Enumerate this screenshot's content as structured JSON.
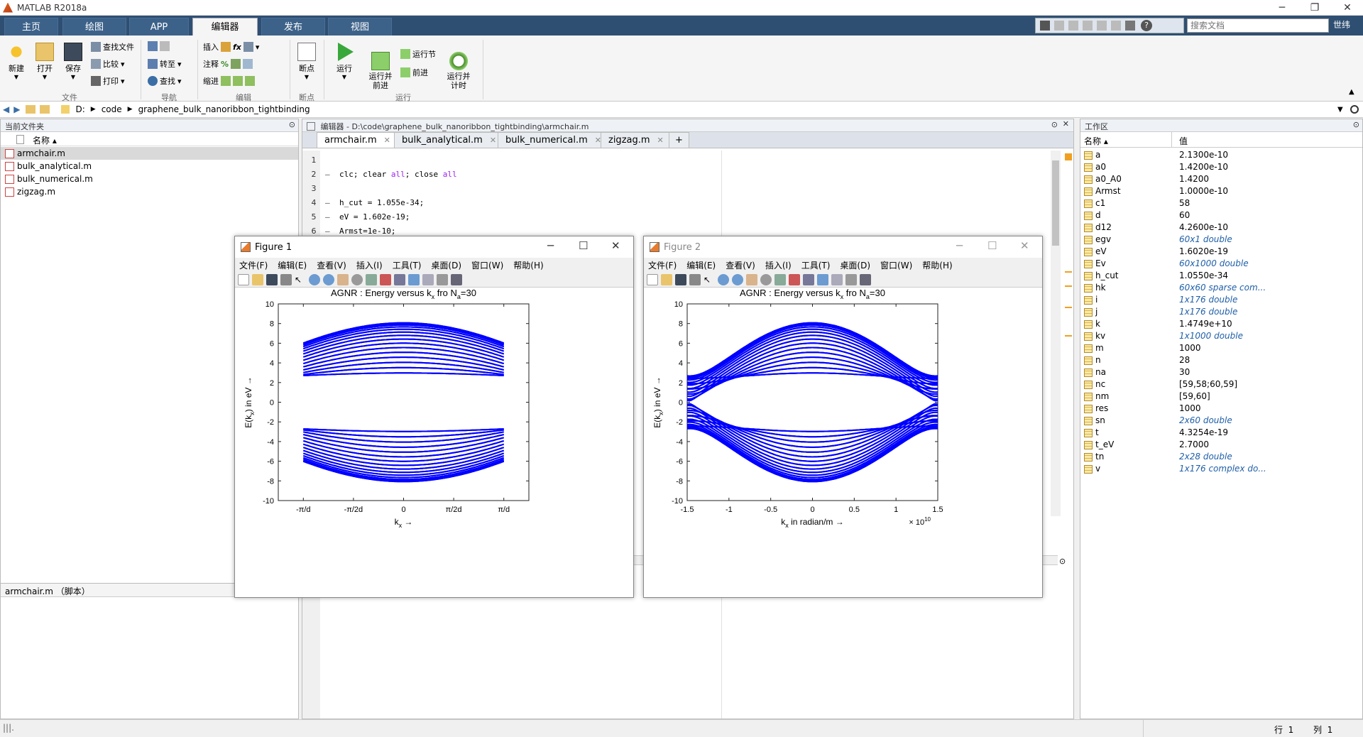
{
  "app": {
    "title": "MATLAB R2018a"
  },
  "main_tabs": [
    {
      "label": "主页"
    },
    {
      "label": "绘图"
    },
    {
      "label": "APP"
    },
    {
      "label": "编辑器"
    },
    {
      "label": "发布"
    },
    {
      "label": "视图"
    }
  ],
  "search": {
    "placeholder": "搜索文档"
  },
  "user": "世纬",
  "ribbon": {
    "file": {
      "new": "新建",
      "open": "打开",
      "save": "保存",
      "find_files": "查找文件",
      "compare": "比较",
      "print": "打印",
      "group": "文件"
    },
    "nav": {
      "goto": "转至",
      "find": "查找",
      "group": "导航"
    },
    "edit": {
      "insert": "插入",
      "comment": "注释",
      "indent": "缩进",
      "group": "编辑"
    },
    "breakpoints": {
      "label": "断点",
      "group": "断点"
    },
    "run": {
      "run": "运行",
      "run_advance": "运行并\n前进",
      "run_section": "运行节",
      "advance": "前进",
      "run_time": "运行并\n计时",
      "group": "运行"
    }
  },
  "address": {
    "parts": [
      "D:",
      "code",
      "graphene_bulk_nanoribbon_tightbinding"
    ]
  },
  "current_folder": {
    "title": "当前文件夹",
    "column": "名称 ▴",
    "files": [
      "armchair.m",
      "bulk_analytical.m",
      "bulk_numerical.m",
      "zigzag.m"
    ],
    "details": "armchair.m （脚本）"
  },
  "editor": {
    "title": "编辑器 - D:\\code\\graphene_bulk_nanoribbon_tightbinding\\armchair.m",
    "tabs": [
      "armchair.m",
      "bulk_analytical.m",
      "bulk_numerical.m",
      "zigzag.m"
    ],
    "lines": [
      {
        "n": "1",
        "dash": "",
        "code": ""
      },
      {
        "n": "2",
        "dash": "—",
        "code": "clc; clear all; close all"
      },
      {
        "n": "3",
        "dash": "",
        "code": ""
      },
      {
        "n": "4",
        "dash": "—",
        "code": "h_cut = 1.055e-34;"
      },
      {
        "n": "5",
        "dash": "—",
        "code": "eV = 1.602e-19;"
      },
      {
        "n": "6",
        "dash": "—",
        "code": "Armst=1e-10;"
      }
    ]
  },
  "workspace": {
    "title": "工作区",
    "col_name": "名称 ▴",
    "col_value": "值",
    "vars": [
      {
        "name": "a",
        "value": "2.1300e-10",
        "italic": false
      },
      {
        "name": "a0",
        "value": "1.4200e-10",
        "italic": false
      },
      {
        "name": "a0_A0",
        "value": "1.4200",
        "italic": false
      },
      {
        "name": "Armst",
        "value": "1.0000e-10",
        "italic": false
      },
      {
        "name": "c1",
        "value": "58",
        "italic": false
      },
      {
        "name": "d",
        "value": "60",
        "italic": false
      },
      {
        "name": "d12",
        "value": "4.2600e-10",
        "italic": false
      },
      {
        "name": "egv",
        "value": "60x1 double",
        "italic": true
      },
      {
        "name": "eV",
        "value": "1.6020e-19",
        "italic": false
      },
      {
        "name": "Ev",
        "value": "60x1000 double",
        "italic": true
      },
      {
        "name": "h_cut",
        "value": "1.0550e-34",
        "italic": false
      },
      {
        "name": "hk",
        "value": "60x60 sparse com...",
        "italic": true
      },
      {
        "name": "i",
        "value": "1x176 double",
        "italic": true
      },
      {
        "name": "j",
        "value": "1x176 double",
        "italic": true
      },
      {
        "name": "k",
        "value": "1.4749e+10",
        "italic": false
      },
      {
        "name": "kv",
        "value": "1x1000 double",
        "italic": true
      },
      {
        "name": "m",
        "value": "1000",
        "italic": false
      },
      {
        "name": "n",
        "value": "28",
        "italic": false
      },
      {
        "name": "na",
        "value": "30",
        "italic": false
      },
      {
        "name": "nc",
        "value": "[59,58;60,59]",
        "italic": false
      },
      {
        "name": "nm",
        "value": "[59,60]",
        "italic": false
      },
      {
        "name": "res",
        "value": "1000",
        "italic": false
      },
      {
        "name": "sn",
        "value": "2x60 double",
        "italic": true
      },
      {
        "name": "t",
        "value": "4.3254e-19",
        "italic": false
      },
      {
        "name": "t_eV",
        "value": "2.7000",
        "italic": false
      },
      {
        "name": "tn",
        "value": "2x28 double",
        "italic": true
      },
      {
        "name": "v",
        "value": "1x176 complex do...",
        "italic": true
      }
    ]
  },
  "figure_menu": [
    "文件(F)",
    "编辑(E)",
    "查看(V)",
    "插入(I)",
    "工具(T)",
    "桌面(D)",
    "窗口(W)",
    "帮助(H)"
  ],
  "figures": [
    {
      "title": "Figure 1"
    },
    {
      "title": "Figure 2"
    }
  ],
  "status": {
    "row_label": "行",
    "row": "1",
    "col_label": "列",
    "col": "1"
  },
  "chart_data": [
    {
      "type": "line",
      "title": "AGNR : Energy versus kx fro Na=30",
      "xlabel": "kx →",
      "ylabel": "E(kx) in eV →",
      "xlim": [
        -1.4749,
        1.4749
      ],
      "ylim": [
        -10,
        10
      ],
      "xtick_labels": [
        "-π/d",
        "-π/2d",
        "0",
        "π/2d",
        "π/d"
      ],
      "ytick_labels": [
        "10",
        "8",
        "6",
        "4",
        "2",
        "0",
        "-2",
        "-4",
        "-6",
        "-8",
        "-10"
      ],
      "series_color": "#0000ff",
      "band_count": 60,
      "band_max_eV": 8.1,
      "band_min_gap_eV": 0.2,
      "band_edge_at_kmax_eV": [
        2.4,
        6.0
      ]
    },
    {
      "type": "line",
      "title": "AGNR : Energy versus kx fro Na=30",
      "xlabel": "kx in radian/m →",
      "ylabel": "E(kx) in eV →",
      "x_multiplier": "× 10^10",
      "xlim": [
        -1.5,
        1.5
      ],
      "ylim": [
        -10,
        10
      ],
      "xtick_labels": [
        "-1.5",
        "-1",
        "-0.5",
        "0",
        "0.5",
        "1",
        "1.5"
      ],
      "ytick_labels": [
        "10",
        "8",
        "6",
        "4",
        "2",
        "0",
        "-2",
        "-4",
        "-6",
        "-8",
        "-10"
      ],
      "series_color": "#0000ff",
      "band_count": 60,
      "period_x": 1.4749
    }
  ]
}
